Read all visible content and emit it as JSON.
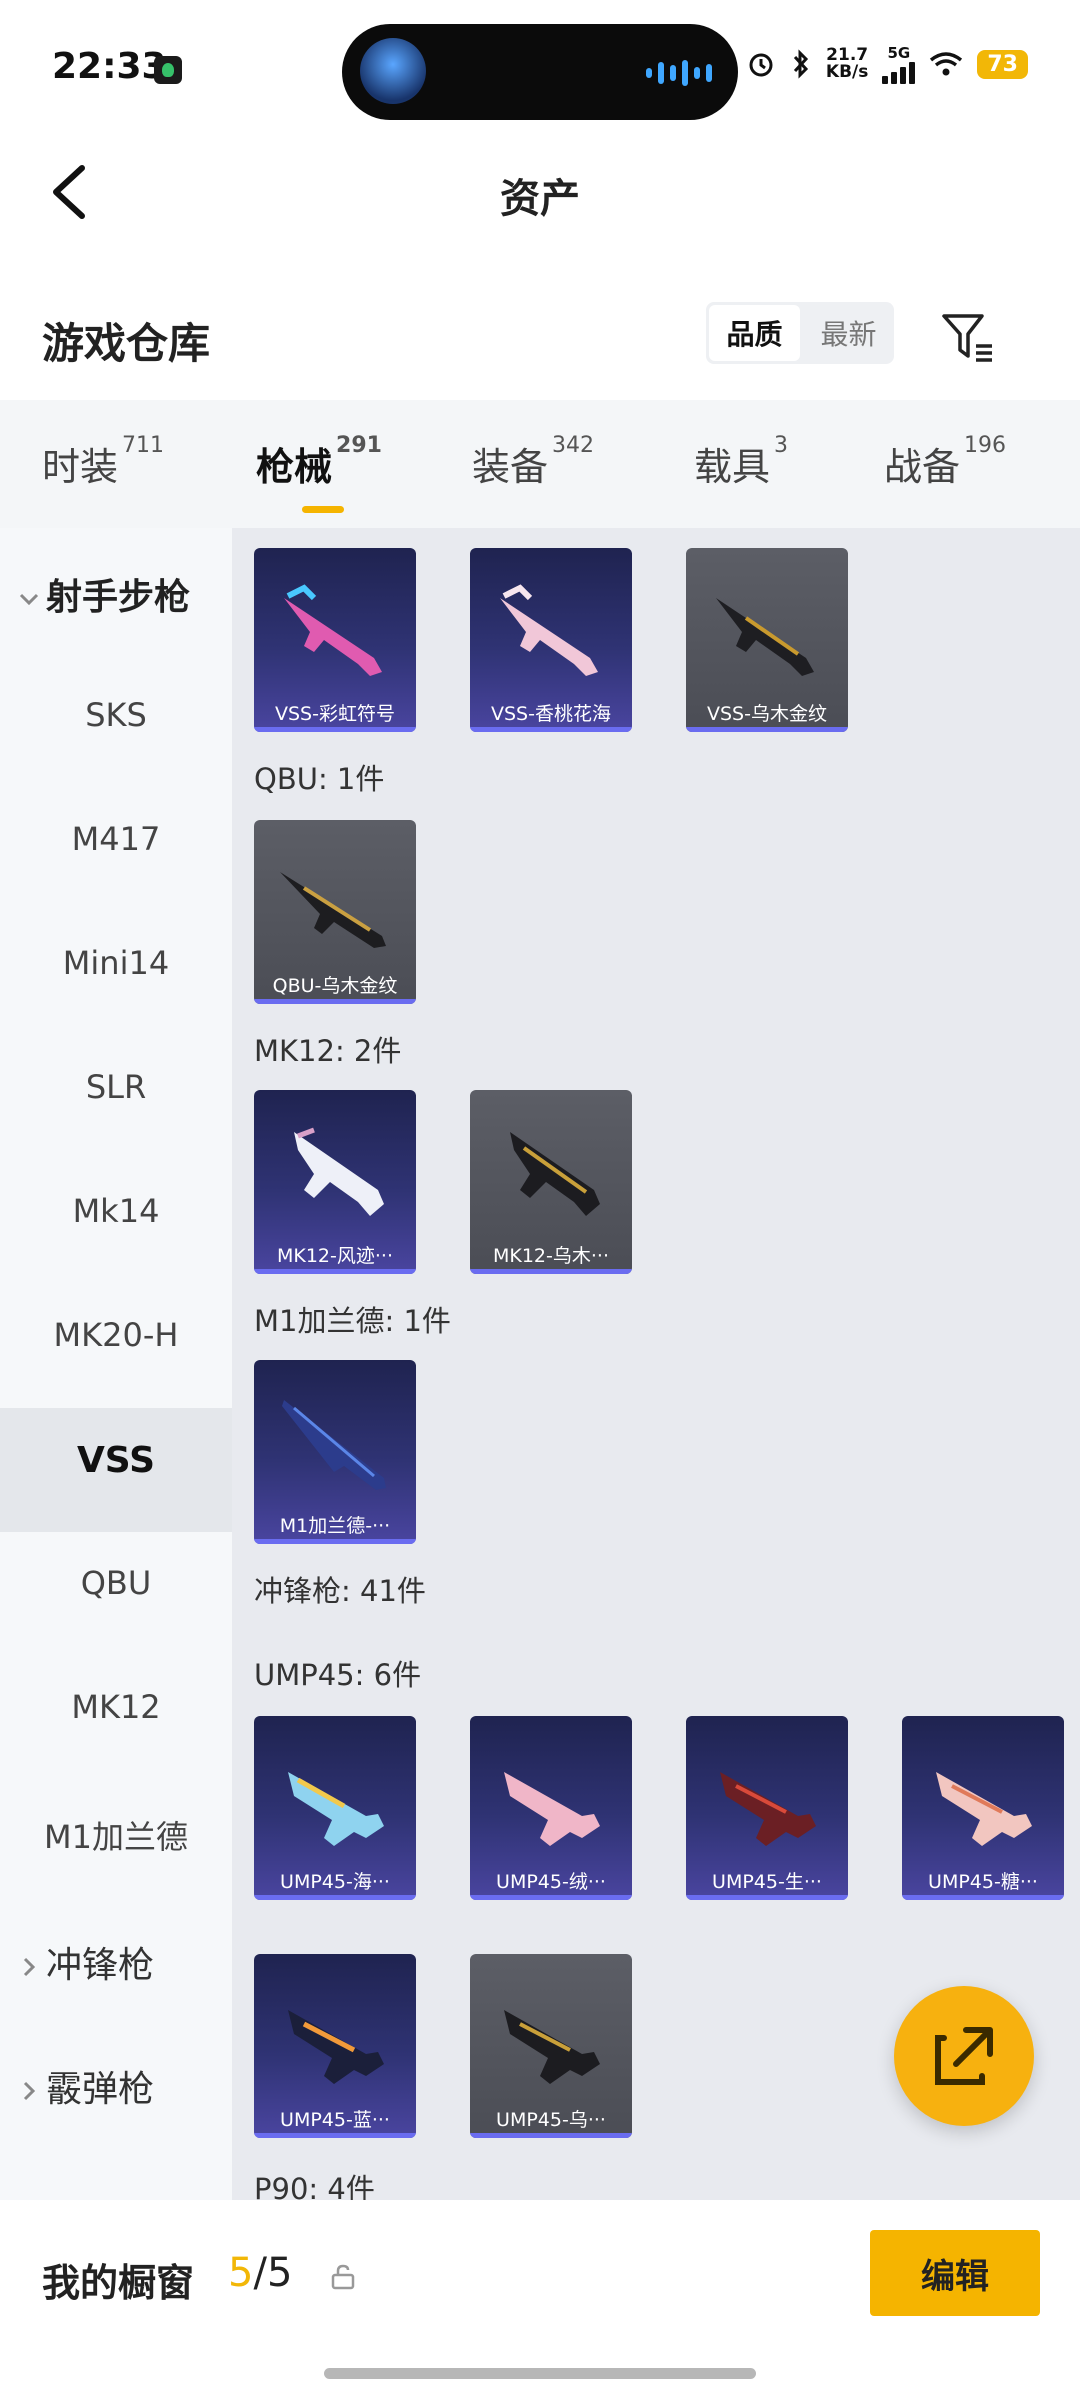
{
  "status_bar": {
    "time": "22:33",
    "speed_value": "21.7",
    "speed_unit": "KB/s",
    "network": "5G",
    "battery": "73"
  },
  "header": {
    "title": "资产"
  },
  "subheader": {
    "title": "游戏仓库",
    "sort_options": [
      "品质",
      "最新"
    ],
    "sort_selected": "品质"
  },
  "tabs": [
    {
      "label": "时装",
      "count": "711"
    },
    {
      "label": "枪械",
      "count": "291"
    },
    {
      "label": "装备",
      "count": "342"
    },
    {
      "label": "载具",
      "count": "3"
    },
    {
      "label": "战备",
      "count": "196"
    }
  ],
  "active_tab": "枪械",
  "sidebar": {
    "group_open": "射手步枪",
    "items": [
      "SKS",
      "M417",
      "Mini14",
      "SLR",
      "Mk14",
      "MK20-H",
      "VSS",
      "QBU",
      "MK12",
      "M1加兰德"
    ],
    "active_item": "VSS",
    "collapsed_groups": [
      "冲锋枪",
      "霰弹枪"
    ]
  },
  "content": {
    "vss_items": [
      "VSS-彩虹符号",
      "VSS-香桃花海",
      "VSS-乌木金纹"
    ],
    "sections": [
      {
        "title": "QBU: 1件",
        "items": [
          "QBU-乌木金纹"
        ]
      },
      {
        "title": "MK12: 2件",
        "items": [
          "MK12-风迹···",
          "MK12-乌木···"
        ]
      },
      {
        "title": "M1加兰德: 1件",
        "items": [
          "M1加兰德-···"
        ]
      },
      {
        "title": "冲锋枪: 41件"
      },
      {
        "title": "UMP45: 6件",
        "items": [
          "UMP45-海···",
          "UMP45-绒···",
          "UMP45-生···",
          "UMP45-糖···",
          "UMP45-蓝···",
          "UMP45-乌···"
        ]
      },
      {
        "title": "P90: 4件"
      }
    ]
  },
  "bottom": {
    "title": "我的橱窗",
    "current": "5",
    "separator": "/",
    "total": "5",
    "edit_label": "编辑"
  },
  "colors": {
    "accent": "#f5b400",
    "card_purple": "#2f3374",
    "card_gray": "#55575f"
  }
}
